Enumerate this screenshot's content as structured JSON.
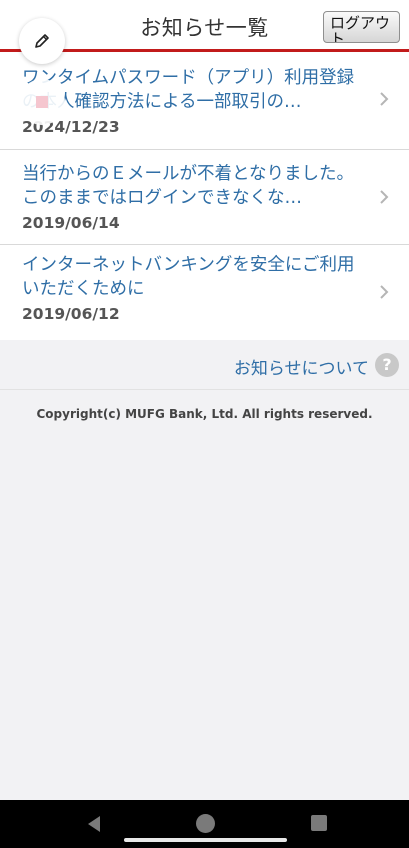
{
  "header": {
    "title": "お知らせ一覧",
    "logout_label": "ログアウト"
  },
  "floating": {
    "edit_icon": "pencil-icon",
    "mark_icon": "pink-square-icon"
  },
  "notices": [
    {
      "title": "ワンタイムパスワード（アプリ）利用登録の本人確認方法による一部取引の…",
      "date": "2024/12/23"
    },
    {
      "title": "当行からのＥメールが不着となりました。このままではログインできなくな…",
      "date": "2019/06/14"
    },
    {
      "title": "インターネットバンキングを安全にご利用いただくために",
      "date": "2019/06/12"
    }
  ],
  "about": {
    "label": "お知らせについて",
    "help_symbol": "?"
  },
  "footer": {
    "copyright": "Copyright(c) MUFG Bank, Ltd. All rights reserved."
  },
  "colors": {
    "accent_red": "#c21b1b",
    "link_blue": "#2f6ea6",
    "background": "#f2f2f4"
  }
}
